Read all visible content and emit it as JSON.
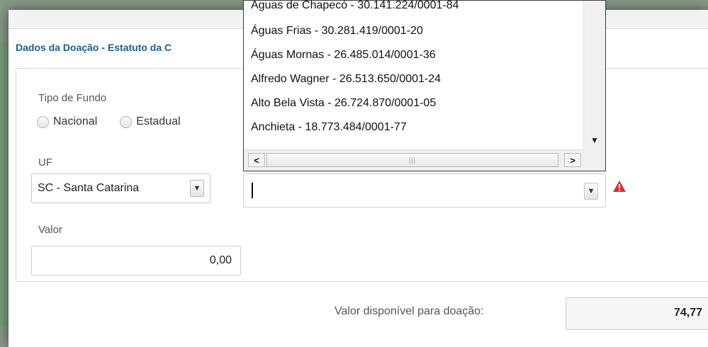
{
  "section_title": "Dados da Doação - Estatuto da C",
  "tipo_fundo": {
    "label": "Tipo de Fundo",
    "options": [
      "Nacional",
      "Estadual"
    ]
  },
  "uf": {
    "label": "UF",
    "selected": "SC - Santa Catarina"
  },
  "municipio": {
    "value": "",
    "options": [
      "Águas de Chapecó - 30.141.224/0001-84",
      "Águas Frias - 30.281.419/0001-20",
      "Águas Mornas - 26.485.014/0001-36",
      "Alfredo Wagner - 26.513.650/0001-24",
      "Alto Bela Vista - 26.724.870/0001-05",
      "Anchieta - 18.773.484/0001-77"
    ]
  },
  "valor": {
    "label": "Valor",
    "value": "0,00"
  },
  "disponivel": {
    "label": "Valor disponível para doação:",
    "value": "74,77"
  },
  "icons": {
    "dropdown_arrow": "chevron-down-icon",
    "warning": "warning-icon",
    "scroll_left": "scroll-left-icon",
    "scroll_right": "scroll-right-icon"
  },
  "colors": {
    "title": "#1f5d8f",
    "warning": "#d93030"
  }
}
